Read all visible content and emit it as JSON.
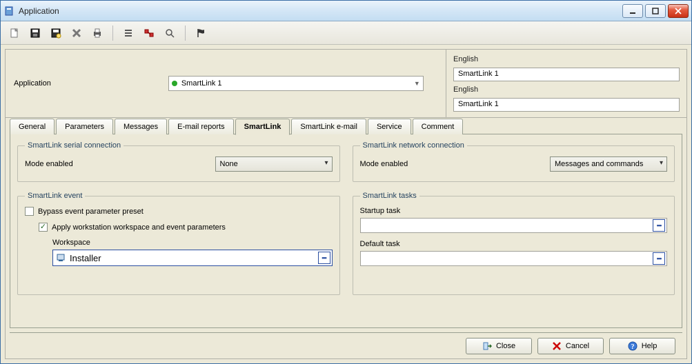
{
  "window": {
    "title": "Application"
  },
  "header": {
    "application_label": "Application",
    "application_value": "SmartLink 1",
    "lang_fields": [
      {
        "label": "English",
        "value": "SmartLink 1"
      },
      {
        "label": "English",
        "value": "SmartLink 1"
      }
    ]
  },
  "tabs": [
    {
      "label": "General"
    },
    {
      "label": "Parameters"
    },
    {
      "label": "Messages"
    },
    {
      "label": "E-mail reports"
    },
    {
      "label": "SmartLink",
      "active": true
    },
    {
      "label": "SmartLink e-mail"
    },
    {
      "label": "Service"
    },
    {
      "label": "Comment"
    }
  ],
  "serial": {
    "legend": "SmartLink serial connection",
    "mode_label": "Mode enabled",
    "mode_value": "None"
  },
  "network": {
    "legend": "SmartLink network connection",
    "mode_label": "Mode enabled",
    "mode_value": "Messages and commands"
  },
  "event": {
    "legend": "SmartLink event",
    "bypass_label": "Bypass event parameter preset",
    "bypass_checked": false,
    "apply_label": "Apply workstation workspace and event parameters",
    "apply_checked": true,
    "workspace_label": "Workspace",
    "workspace_value": "Installer"
  },
  "tasks": {
    "legend": "SmartLink tasks",
    "startup_label": "Startup task",
    "startup_value": "",
    "default_label": "Default task",
    "default_value": ""
  },
  "footer": {
    "close": "Close",
    "cancel": "Cancel",
    "help": "Help"
  }
}
